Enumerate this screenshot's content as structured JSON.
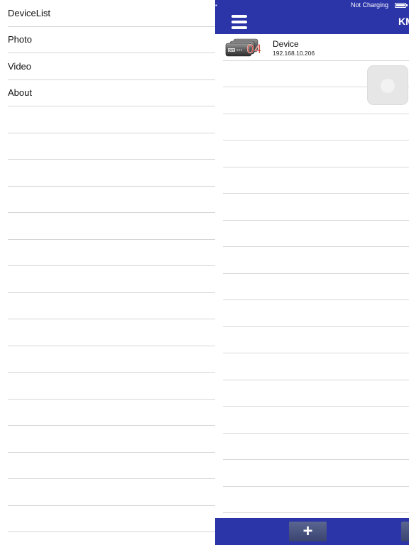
{
  "status_bar": {
    "charging_text": "Not Charging"
  },
  "navbar": {
    "title": "KM"
  },
  "menu": {
    "items": [
      {
        "label": "DeviceList"
      },
      {
        "label": "Photo"
      },
      {
        "label": "Video"
      },
      {
        "label": "About"
      }
    ]
  },
  "devices": [
    {
      "name": "Device",
      "ip": "192.168.10.206",
      "icon": "dvr-icon",
      "icon_label": "DVR",
      "channels": "04"
    }
  ],
  "bottom_bar": {
    "add_label": "+"
  },
  "colors": {
    "navbar": "#2c35a8",
    "menu_text": "#111111",
    "channel_number": "#cc2a1e"
  }
}
